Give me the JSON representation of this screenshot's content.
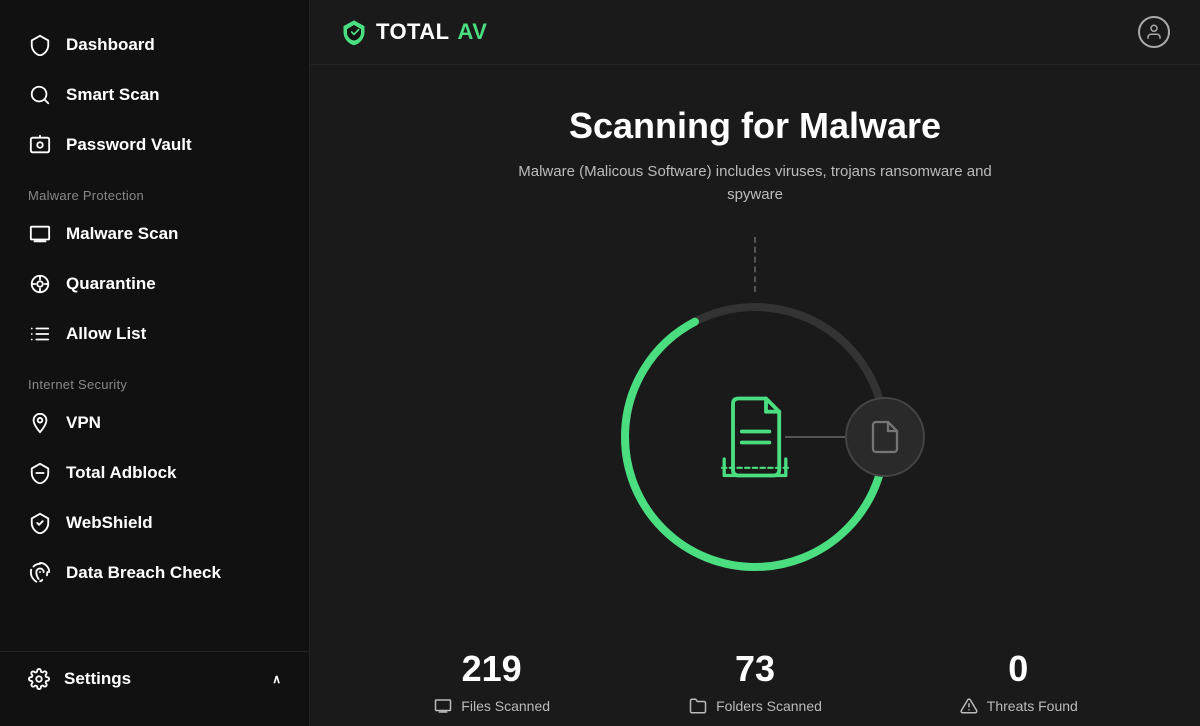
{
  "sidebar": {
    "items": [
      {
        "id": "dashboard",
        "label": "Dashboard",
        "icon": "shield"
      },
      {
        "id": "smart-scan",
        "label": "Smart Scan",
        "icon": "search"
      },
      {
        "id": "password-vault",
        "label": "Password Vault",
        "icon": "vault"
      }
    ],
    "malware_section_label": "Malware Protection",
    "malware_items": [
      {
        "id": "malware-scan",
        "label": "Malware Scan",
        "icon": "printer"
      },
      {
        "id": "quarantine",
        "label": "Quarantine",
        "icon": "gear"
      },
      {
        "id": "allow-list",
        "label": "Allow List",
        "icon": "list"
      }
    ],
    "internet_section_label": "Internet Security",
    "internet_items": [
      {
        "id": "vpn",
        "label": "VPN",
        "icon": "location"
      },
      {
        "id": "total-adblock",
        "label": "Total Adblock",
        "icon": "shield2"
      },
      {
        "id": "webshield",
        "label": "WebShield",
        "icon": "shield3"
      },
      {
        "id": "data-breach",
        "label": "Data Breach Check",
        "icon": "fingerprint"
      }
    ],
    "settings_label": "Settings",
    "settings_chevron": "∧"
  },
  "header": {
    "logo_text_total": "TOTAL",
    "logo_text_av": "AV"
  },
  "main": {
    "title": "Scanning for Malware",
    "subtitle": "Malware (Malicous Software) includes viruses, trojans ransomware and spyware",
    "stats": [
      {
        "id": "files-scanned",
        "value": "219",
        "label": "Files Scanned",
        "icon": "file"
      },
      {
        "id": "folders-scanned",
        "value": "73",
        "label": "Folders Scanned",
        "icon": "folder"
      },
      {
        "id": "threats-found",
        "value": "0",
        "label": "Threats Found",
        "icon": "warning"
      }
    ]
  }
}
